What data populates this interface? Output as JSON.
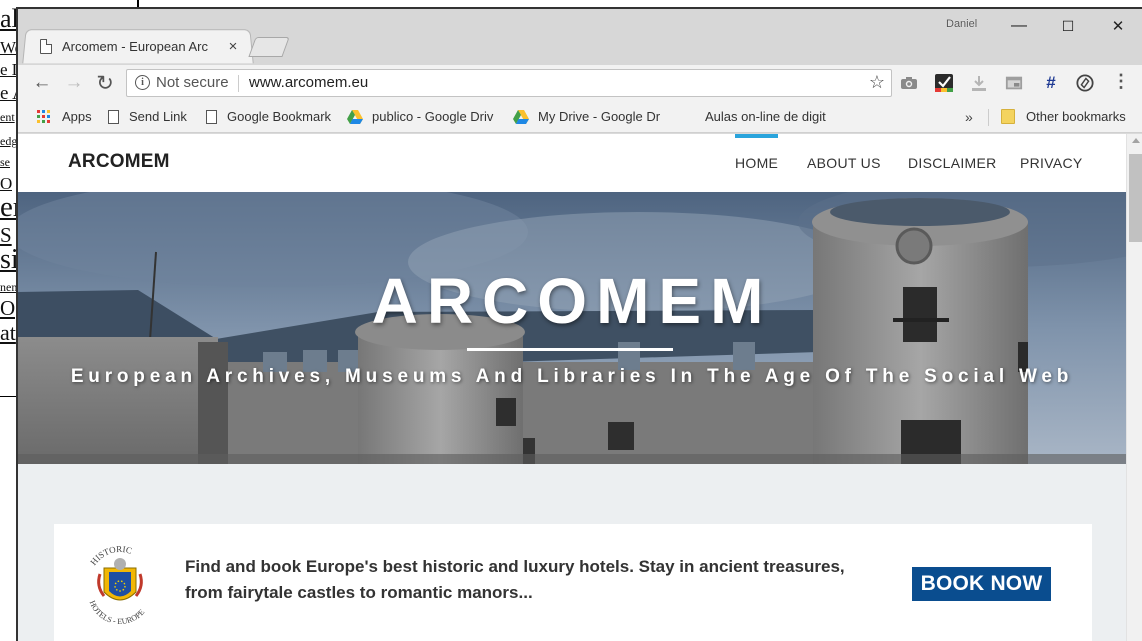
{
  "background_page": {
    "fragments": [
      "al",
      "We",
      "e D",
      "e A",
      "ent",
      "edg",
      "se",
      "O",
      "er",
      "S",
      "sis",
      "nen",
      "O",
      "at"
    ]
  },
  "browser": {
    "tab": {
      "title": "Arcomem - European Arc",
      "close": "×"
    },
    "user": "Daniel",
    "window_controls": {
      "minimize": "—",
      "maximize": "☐",
      "close": "✕"
    },
    "nav": {
      "back": "←",
      "forward": "→",
      "reload": "↻"
    },
    "address": {
      "security_label": "Not secure",
      "url": "www.arcomem.eu",
      "star": "☆"
    },
    "extensions": [
      "camera-extension-icon",
      "task-extension-icon",
      "download-extension-icon",
      "window-extension-icon",
      "hashtag-extension-icon",
      "circle-extension-icon"
    ],
    "hashtag": "#",
    "menu": "⋮",
    "bookmarks": [
      {
        "label": "Apps",
        "icon": "apps-grid-icon"
      },
      {
        "label": "Send Link",
        "icon": "page-icon"
      },
      {
        "label": "Google Bookmark",
        "icon": "page-icon"
      },
      {
        "label": "publico - Google Driv",
        "icon": "google-drive-icon"
      },
      {
        "label": "My Drive - Google Dr",
        "icon": "google-drive-icon"
      },
      {
        "label": "Aulas on-line de digit",
        "icon": "none"
      }
    ],
    "bookmarks_overflow": "»",
    "other_bookmarks": "Other bookmarks"
  },
  "site": {
    "logo": "ARCOMEM",
    "nav": [
      "HOME",
      "ABOUT US",
      "DISCLAIMER",
      "PRIVACY"
    ],
    "active_nav": "HOME",
    "hero": {
      "title": "ARCOMEM",
      "subtitle": "European Archives, Museums And Libraries In The Age Of The Social Web"
    },
    "ad": {
      "seal_top": "HISTORIC",
      "seal_bottom": "HOTELS - EUROPE",
      "line1": "Find and book Europe's best historic and luxury hotels. Stay in ancient treasures,",
      "line2": "from fairytale castles to romantic manors...",
      "button": "BOOK NOW"
    }
  },
  "colors": {
    "accent": "#2aa4dc",
    "book_button": "#0a4d8f",
    "page_background": "#eceff1"
  }
}
